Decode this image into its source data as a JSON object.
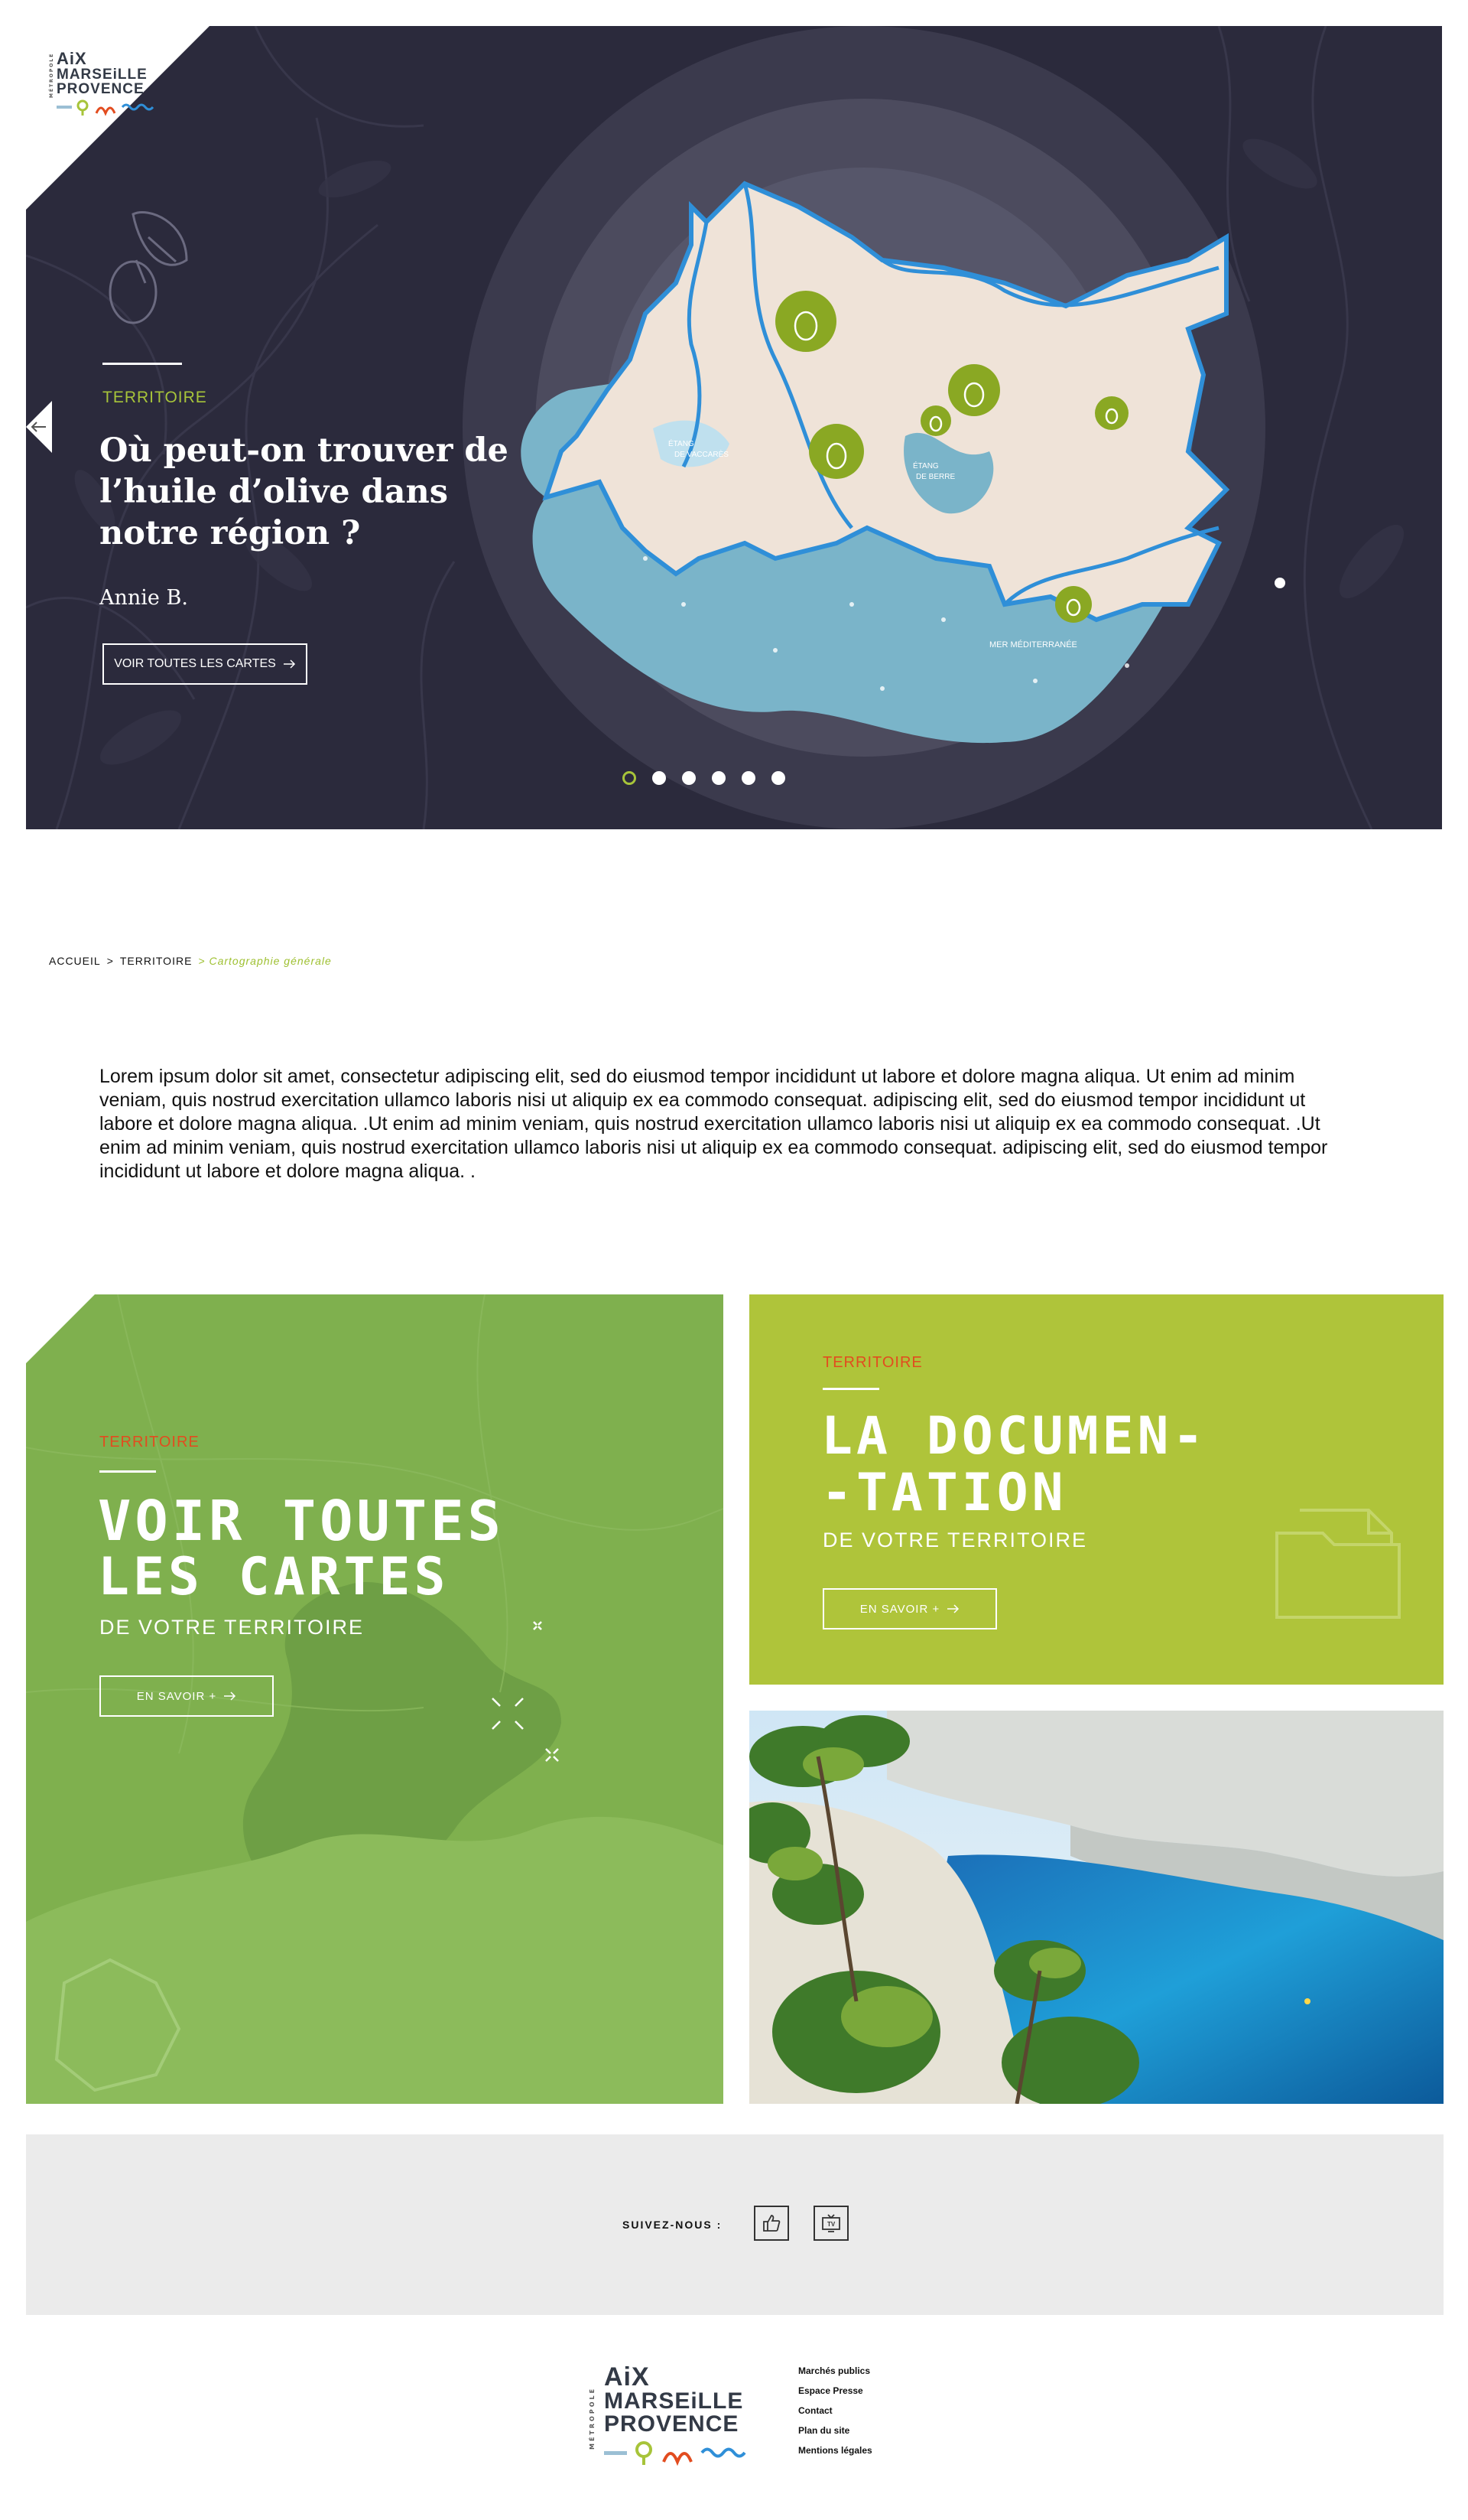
{
  "brand": {
    "vertical": "MÉTROPOLE",
    "line1": "AiX",
    "line2": "MARSEiLLE",
    "line3": "PROVENCE"
  },
  "hero": {
    "tag": "TERRITOIRE",
    "title": "Où peut-on trouver de l’huile d’olive dans notre région ?",
    "author": "Annie B.",
    "button_label": "VOIR TOUTES LES CARTES",
    "button_icon": "arrow-right-icon",
    "map_labels": {
      "lake1_line1": "ÉTANG",
      "lake1_line2": "DE VACCARÈS",
      "lake2_line1": "ÉTANG",
      "lake2_line2": "DE BERRE",
      "sea": "MER MÉDITERRANÉE"
    },
    "slides_total": 6,
    "active_slide": 1
  },
  "breadcrumb": {
    "items": [
      "ACCUEIL",
      "TERRITOIRE"
    ],
    "separator": ">",
    "current": "Cartographie générale"
  },
  "intro": {
    "text": "Lorem ipsum dolor sit amet, consectetur adipiscing elit, sed do eiusmod tempor incididunt ut labore et dolore magna aliqua. Ut enim ad minim veniam, quis nostrud exercitation ullamco laboris nisi ut aliquip ex ea commodo consequat. adipiscing elit, sed do eiusmod tempor incididunt ut labore et dolore magna aliqua. .Ut enim ad minim veniam, quis nostrud exercitation ullamco laboris nisi ut aliquip ex ea commodo consequat. .Ut enim ad minim veniam, quis nostrud exercitation ullamco laboris nisi ut aliquip ex ea commodo consequat. adipiscing elit, sed do eiusmod tempor incididunt ut labore et dolore magna aliqua. ."
  },
  "cards": {
    "maps": {
      "tag": "TERRITOIRE",
      "title_line1": "VOIR TOUTES",
      "title_line2": "LES CARTES",
      "subtitle": "DE VOTRE TERRITOIRE",
      "button_label": "EN SAVOIR +"
    },
    "doc": {
      "tag": "TERRITOIRE",
      "title_line1": "LA DOCUMEN-",
      "title_line2": "-TATION",
      "subtitle": "DE VOTRE TERRITOIRE",
      "button_label": "EN SAVOIR +",
      "icon": "folder-icon"
    },
    "photo": {
      "subject": "calanque-photo"
    }
  },
  "social": {
    "label": "SUIVEZ-NOUS :",
    "icons": [
      "like-icon",
      "tv-icon"
    ]
  },
  "footer": {
    "links": [
      "Marchés publics",
      "Espace Presse",
      "Contact",
      "Plan du site",
      "Mentions légales"
    ]
  },
  "colors": {
    "hero_bg": "#2b2a3c",
    "accent_green": "#a7c43a",
    "accent_orange": "#e24c1f",
    "card_maps": "#7fb04e",
    "card_doc": "#afc43a",
    "sea": "#7ab4c9",
    "land": "#efe3d8",
    "river": "#2f8fd8"
  }
}
